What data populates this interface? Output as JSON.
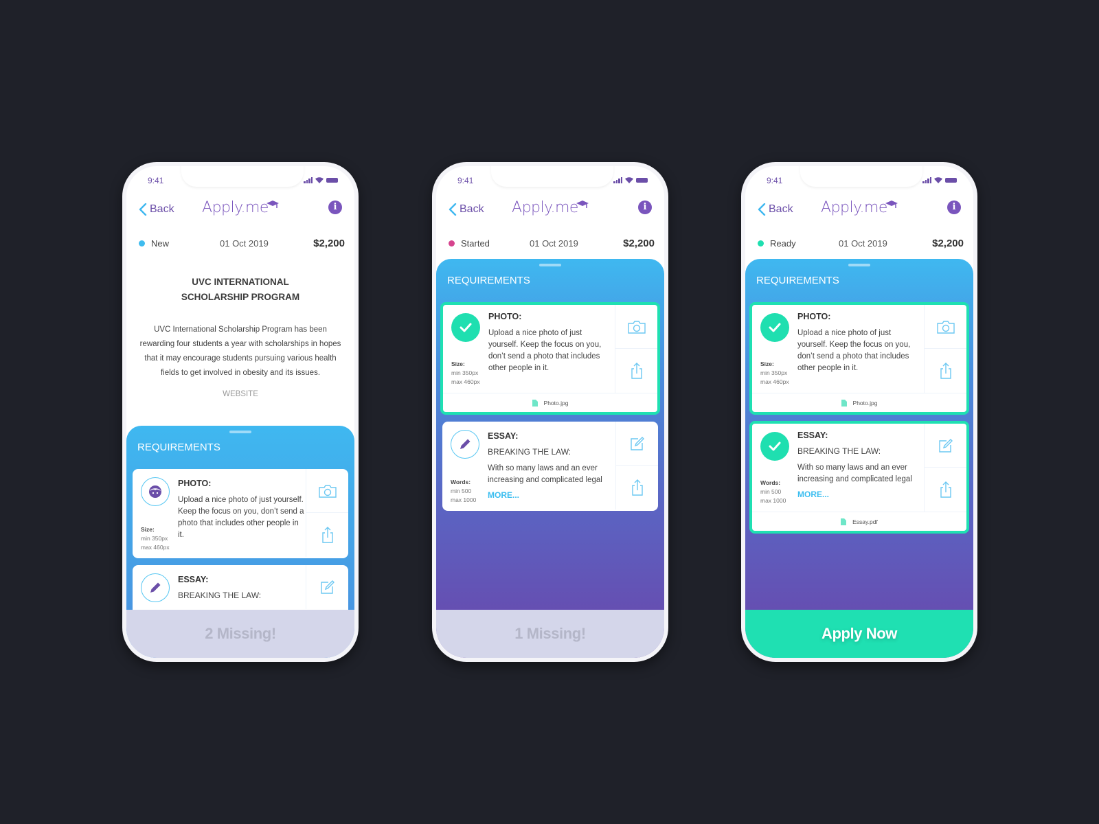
{
  "app": {
    "status_time": "9:41",
    "back_label": "Back",
    "logo_text": "Apply.me",
    "info_icon": "i"
  },
  "program": {
    "date": "01 Oct 2019",
    "amount": "$2,200",
    "title_line1": "UVC INTERNATIONAL",
    "title_line2": "SCHOLARSHIP PROGRAM",
    "description": "UVC International Scholarship Program has been rewarding four students a year with scholarships in hopes that it may encourage students pursuing various health fields to get involved in obesity and its issues.",
    "website_label": "WEBSITE"
  },
  "requirements_label": "REQUIREMENTS",
  "photo_req": {
    "title": "PHOTO:",
    "text": "Upload a nice photo of just yourself. Keep the focus on you, don’t send a photo that includes other people in it.",
    "spec_label": "Size:",
    "spec_min": "min 350px",
    "spec_max": "max 460px",
    "file": "Photo.jpg"
  },
  "essay_req": {
    "title": "ESSAY:",
    "subtitle": "BREAKING THE LAW:",
    "text": "With so many laws and an ever increasing and complicated legal",
    "more": "MORE...",
    "spec_label": "Words:",
    "spec_min": "min  500",
    "spec_max": "max 1000",
    "file": "Essay.pdf"
  },
  "screens": [
    {
      "status": "New",
      "status_color": "#3fbcef",
      "footer": "2 Missing!"
    },
    {
      "status": "Started",
      "status_color": "#d6448e",
      "footer": "1 Missing!"
    },
    {
      "status": "Ready",
      "status_color": "#1fdfb0",
      "footer": "Apply Now"
    }
  ],
  "colors": {
    "accent": "#7a55bd",
    "blue": "#3fb8f0",
    "success": "#1fe0b2",
    "missing_bg": "#d4d6ea"
  }
}
